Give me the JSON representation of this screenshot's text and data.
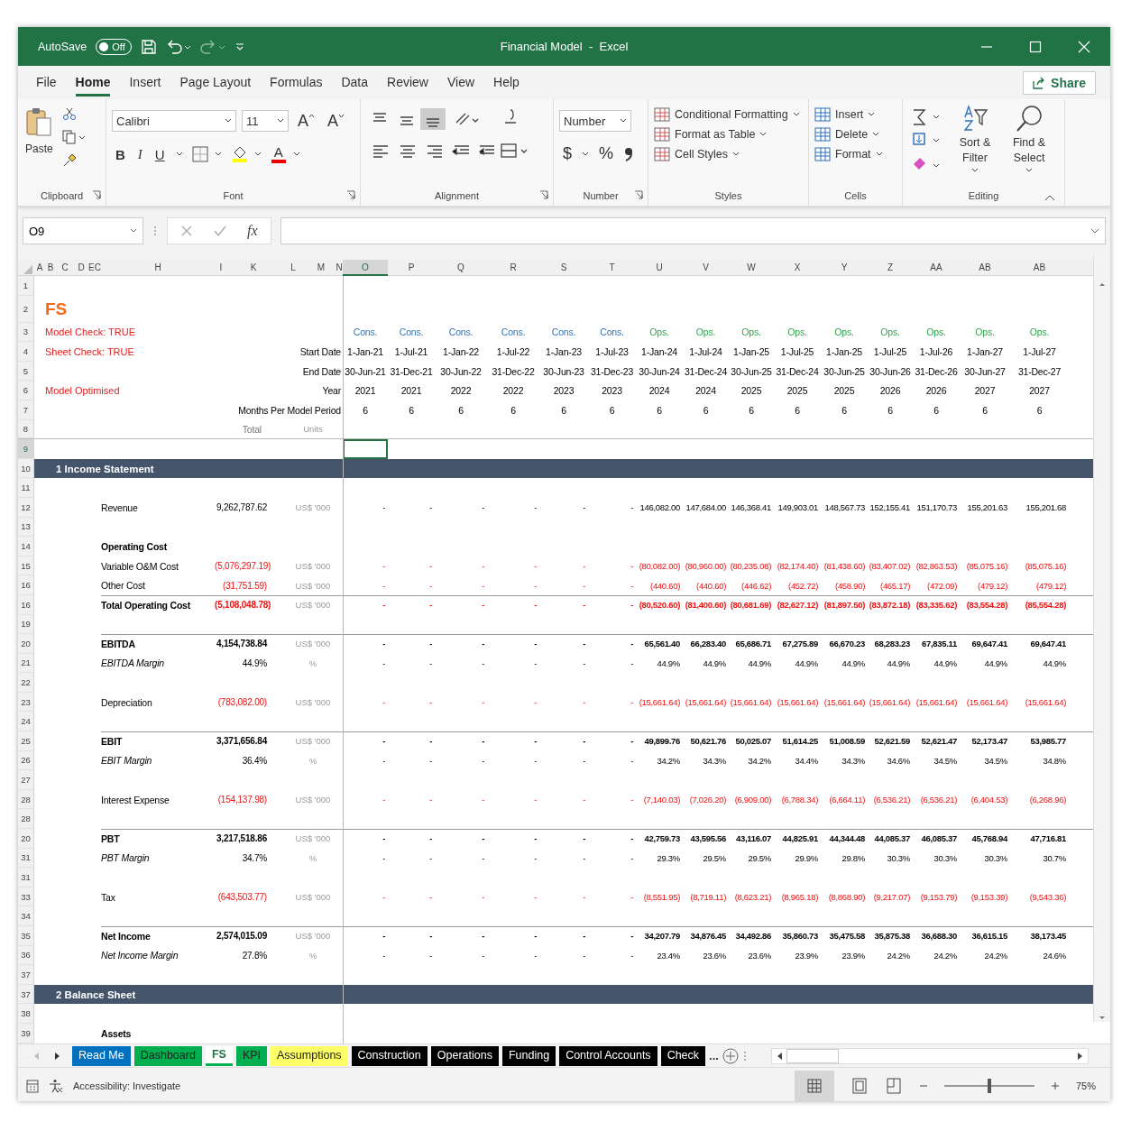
{
  "title_bar": {
    "autosave": "AutoSave",
    "autosave_toggle": {
      "label": "Off",
      "on": false
    },
    "title": "Financial Model  -  Excel"
  },
  "ribbon": {
    "tabs": [
      {
        "label": "File",
        "selected": false
      },
      {
        "label": "Home",
        "selected": true
      },
      {
        "label": "Insert",
        "selected": false
      },
      {
        "label": "Page Layout",
        "selected": false
      },
      {
        "label": "Formulas",
        "selected": false
      },
      {
        "label": "Data",
        "selected": false
      },
      {
        "label": "Review",
        "selected": false
      },
      {
        "label": "View",
        "selected": false
      },
      {
        "label": "Help",
        "selected": false
      }
    ],
    "share": "Share",
    "clipboard": {
      "paste": "Paste",
      "group": "Clipboard"
    },
    "font": {
      "name": "Calibri",
      "size": "11",
      "grow": "A",
      "shrink": "A",
      "styles": [
        "B",
        "I",
        "U"
      ],
      "color_letter": "A",
      "group": "Font"
    },
    "alignment": {
      "group": "Alignment"
    },
    "number": {
      "format": "Number",
      "currency": "$",
      "percent": "%",
      "group": "Number"
    },
    "styles": {
      "items": [
        "Conditional Formatting",
        "Format as Table",
        "Cell Styles"
      ],
      "group": "Styles"
    },
    "cells": {
      "items": [
        "Insert",
        "Delete",
        "Format"
      ],
      "group": "Cells"
    },
    "editing": {
      "sort": "Sort & Filter",
      "find": "Find & Select",
      "group": "Editing"
    }
  },
  "formula_bar": {
    "name_box": "O9",
    "fx": "fx"
  },
  "sheet": {
    "columns": [
      {
        "label": "A",
        "selected": false
      },
      {
        "label": "B",
        "selected": false
      },
      {
        "label": "C",
        "selected": false
      },
      {
        "label": "D",
        "selected": false
      },
      {
        "label": "EC",
        "selected": false
      },
      {
        "label": "H",
        "selected": false
      },
      {
        "label": "I",
        "selected": false
      },
      {
        "label": "K",
        "selected": false
      },
      {
        "label": "L",
        "selected": false
      },
      {
        "label": "M",
        "selected": false
      },
      {
        "label": "N",
        "selected": false
      },
      {
        "label": "O",
        "selected": true
      },
      {
        "label": "P",
        "selected": false
      },
      {
        "label": "Q",
        "selected": false
      },
      {
        "label": "R",
        "selected": false
      },
      {
        "label": "S",
        "selected": false
      },
      {
        "label": "T",
        "selected": false
      },
      {
        "label": "U",
        "selected": false
      },
      {
        "label": "V",
        "selected": false
      },
      {
        "label": "W",
        "selected": false
      },
      {
        "label": "X",
        "selected": false
      },
      {
        "label": "Y",
        "selected": false
      },
      {
        "label": "Z",
        "selected": false
      },
      {
        "label": "AA",
        "selected": false
      },
      {
        "label": "AB",
        "selected": false
      },
      {
        "label": "AB",
        "selected": false
      }
    ],
    "periods": [
      {
        "phase": "Cons.",
        "kind": "construction",
        "start": "1-Jan-21",
        "end": "30-Jun-21",
        "year": "2021",
        "months": "6"
      },
      {
        "phase": "Cons.",
        "kind": "construction",
        "start": "1-Jul-21",
        "end": "31-Dec-21",
        "year": "2021",
        "months": "6"
      },
      {
        "phase": "Cons.",
        "kind": "construction",
        "start": "1-Jan-22",
        "end": "30-Jun-22",
        "year": "2022",
        "months": "6"
      },
      {
        "phase": "Cons.",
        "kind": "construction",
        "start": "1-Jul-22",
        "end": "31-Dec-22",
        "year": "2022",
        "months": "6"
      },
      {
        "phase": "Cons.",
        "kind": "construction",
        "start": "1-Jan-23",
        "end": "30-Jun-23",
        "year": "2023",
        "months": "6"
      },
      {
        "phase": "Cons.",
        "kind": "construction",
        "start": "1-Jul-23",
        "end": "31-Dec-23",
        "year": "2023",
        "months": "6"
      },
      {
        "phase": "Ops.",
        "kind": "operations",
        "start": "1-Jan-24",
        "end": "30-Jun-24",
        "year": "2024",
        "months": "6"
      },
      {
        "phase": "Ops.",
        "kind": "operations",
        "start": "1-Jul-24",
        "end": "31-Dec-24",
        "year": "2024",
        "months": "6"
      },
      {
        "phase": "Ops.",
        "kind": "operations",
        "start": "1-Jan-25",
        "end": "30-Jun-25",
        "year": "2025",
        "months": "6"
      },
      {
        "phase": "Ops.",
        "kind": "operations",
        "start": "1-Jul-25",
        "end": "31-Dec-24",
        "year": "2025",
        "months": "6"
      },
      {
        "phase": "Ops.",
        "kind": "operations",
        "start": "1-Jan-25",
        "end": "30-Jun-25",
        "year": "2025",
        "months": "6"
      },
      {
        "phase": "Ops.",
        "kind": "operations",
        "start": "1-Jul-25",
        "end": "30-Jun-26",
        "year": "2026",
        "months": "6"
      },
      {
        "phase": "Ops.",
        "kind": "operations",
        "start": "1-Jul-26",
        "end": "31-Dec-26",
        "year": "2026",
        "months": "6"
      },
      {
        "phase": "Ops.",
        "kind": "operations",
        "start": "1-Jan-27",
        "end": "30-Jun-27",
        "year": "2027",
        "months": "6"
      },
      {
        "phase": "Ops.",
        "kind": "operations",
        "start": "1-Jul-27",
        "end": "31-Dec-27",
        "year": "2027",
        "months": "6"
      }
    ],
    "rows": [
      {
        "num": "1",
        "kind": "blank",
        "selected": false
      },
      {
        "num": "2",
        "kind": "sheet-title",
        "text": "FS",
        "selected": false
      },
      {
        "num": "3",
        "kind": "phase",
        "note": "Model Check: TRUE",
        "selected": false
      },
      {
        "num": "4",
        "kind": "start",
        "note": "Sheet Check: TRUE",
        "label": "Start Date",
        "selected": false
      },
      {
        "num": "5",
        "kind": "end",
        "label": "End Date",
        "selected": false
      },
      {
        "num": "6",
        "kind": "year",
        "note": "Model Optimised",
        "label": "Year",
        "selected": false
      },
      {
        "num": "7",
        "kind": "months",
        "label": "Months Per Model Period",
        "selected": false
      },
      {
        "num": "8",
        "kind": "column-labels",
        "total": "Total",
        "units": "Units",
        "selected": false
      },
      {
        "num": "9",
        "kind": "blank",
        "selected": true
      },
      {
        "num": "10",
        "kind": "section",
        "text": "1  Income Statement",
        "selected": false
      },
      {
        "num": "11",
        "kind": "blank",
        "selected": false
      },
      {
        "num": "12",
        "kind": "line",
        "label": "Revenue",
        "total": "9,262,787.62",
        "units": "US$ '000",
        "values": [
          "-",
          "-",
          "-",
          "-",
          "-",
          "-",
          "146,082.00",
          "147,684.00",
          "146,368.41",
          "149,903.01",
          "148,567.73",
          "152,155.41",
          "151,170.73",
          "155,201.63",
          "155,201.68"
        ],
        "selected": false
      },
      {
        "num": "13",
        "kind": "blank",
        "selected": false
      },
      {
        "num": "14",
        "kind": "subheading",
        "label": "Operating Cost",
        "selected": false
      },
      {
        "num": "15",
        "kind": "cost",
        "label": "Variable O&M Cost",
        "total": "(5,076,297.19)",
        "units": "US$ '000",
        "values": [
          "-",
          "-",
          "-",
          "-",
          "-",
          "-",
          "(80,082.00)",
          "(80,960.00)",
          "(80,235.08)",
          "(82,174.40)",
          "(81,438.60)",
          "(83,407.02)",
          "(82,863.53)",
          "(85,075.16)",
          "(85,075.16)"
        ],
        "selected": false
      },
      {
        "num": "16",
        "kind": "cost",
        "label": "Other Cost",
        "total": "(31,751.59)",
        "units": "US$ '000",
        "values": [
          "-",
          "-",
          "-",
          "-",
          "-",
          "-",
          "(440.60)",
          "(440.60)",
          "(446.62)",
          "(452.72)",
          "(458.90)",
          "(465.17)",
          "(472.09)",
          "(479.12)",
          "(479.12)"
        ],
        "selected": false
      },
      {
        "num": "16",
        "kind": "total-cost",
        "label": "Total Operating Cost",
        "total": "(5,108,048.78)",
        "units": "US$ '000",
        "values": [
          "-",
          "-",
          "-",
          "-",
          "-",
          "-",
          "(80,520.60)",
          "(81,400.60)",
          "(80,681.69)",
          "(82,627.12)",
          "(81,897.50)",
          "(83,872.18)",
          "(83,335.62)",
          "(83,554.28)",
          "(85,554.28)"
        ],
        "selected": false
      },
      {
        "num": "19",
        "kind": "blank",
        "selected": false
      },
      {
        "num": "20",
        "kind": "total",
        "label": "EBITDA",
        "total": "4,154,738.84",
        "units": "US$ '000",
        "values": [
          "-",
          "-",
          "-",
          "-",
          "-",
          "-",
          "65,561.40",
          "66,283.40",
          "65,686.71",
          "67,275.89",
          "66,670.23",
          "68,283.23",
          "67,835.11",
          "69,647.41",
          "69,647.41"
        ],
        "selected": false
      },
      {
        "num": "21",
        "kind": "margin",
        "label": "EBITDA Margin",
        "total": "44.9%",
        "units": "%",
        "values": [
          "-",
          "-",
          "-",
          "-",
          "-",
          "-",
          "44.9%",
          "44.9%",
          "44.9%",
          "44.9%",
          "44.9%",
          "44.9%",
          "44.9%",
          "44.9%",
          "44.9%"
        ],
        "selected": false
      },
      {
        "num": "22",
        "kind": "blank",
        "selected": false
      },
      {
        "num": "23",
        "kind": "cost",
        "label": "Depreciation",
        "total": "(783,082.00)",
        "units": "US$ '000",
        "values": [
          "-",
          "-",
          "-",
          "-",
          "-",
          "-",
          "(15,661.64)",
          "(15,661.64)",
          "(15,661.64)",
          "(15,661.64)",
          "(15,661.64)",
          "(15,661.64)",
          "(15,661.64)",
          "(15,661.64)",
          "(15,661.64)"
        ],
        "selected": false
      },
      {
        "num": "24",
        "kind": "blank",
        "selected": false
      },
      {
        "num": "25",
        "kind": "total",
        "label": "EBIT",
        "total": "3,371,656.84",
        "units": "US$ '000",
        "values": [
          "-",
          "-",
          "-",
          "-",
          "-",
          "-",
          "49,899.76",
          "50,621.76",
          "50,025.07",
          "51,614.25",
          "51,008.59",
          "52,621.59",
          "52,621.47",
          "52,173.47",
          "53,985.77"
        ],
        "selected": false
      },
      {
        "num": "26",
        "kind": "margin",
        "label": "EBIT Margin",
        "total": "36.4%",
        "units": "%",
        "values": [
          "-",
          "-",
          "-",
          "-",
          "-",
          "-",
          "34.2%",
          "34.3%",
          "34.2%",
          "34.4%",
          "34.3%",
          "34.6%",
          "34.5%",
          "34.5%",
          "34.8%"
        ],
        "selected": false
      },
      {
        "num": "27",
        "kind": "blank",
        "selected": false
      },
      {
        "num": "28",
        "kind": "cost",
        "label": "Interest Expense",
        "total": "(154,137.98)",
        "units": "US$ '000",
        "values": [
          "-",
          "-",
          "-",
          "-",
          "-",
          "-",
          "(7,140.03)",
          "(7,026.20)",
          "(6,909.00)",
          "(6,788.34)",
          "(6,664.11)",
          "(6,536.21)",
          "(6,536.21)",
          "(6,404.53)",
          "(6,268.96)"
        ],
        "selected": false
      },
      {
        "num": "28",
        "kind": "blank",
        "selected": false
      },
      {
        "num": "20",
        "kind": "total",
        "label": "PBT",
        "total": "3,217,518.86",
        "units": "US$ '000",
        "values": [
          "-",
          "-",
          "-",
          "-",
          "-",
          "-",
          "42,759.73",
          "43,595.56",
          "43,116.07",
          "44,825.91",
          "44,344.48",
          "44,085.37",
          "46,085.37",
          "45,768.94",
          "47,716.81"
        ],
        "selected": false
      },
      {
        "num": "31",
        "kind": "margin",
        "label": "PBT Margin",
        "total": "34.7%",
        "units": "%",
        "values": [
          "-",
          "-",
          "-",
          "-",
          "-",
          "-",
          "29.3%",
          "29.5%",
          "29.5%",
          "29.9%",
          "29.8%",
          "30.3%",
          "30.3%",
          "30.3%",
          "30.7%"
        ],
        "selected": false
      },
      {
        "num": "31",
        "kind": "blank",
        "selected": false
      },
      {
        "num": "33",
        "kind": "cost",
        "label": "Tax",
        "total": "(643,503.77)",
        "units": "US$ '000",
        "values": [
          "-",
          "-",
          "-",
          "-",
          "-",
          "-",
          "(8,551.95)",
          "(8,719.11)",
          "(8,623.21)",
          "(8,965.18)",
          "(8,868.90)",
          "(9,217.07)",
          "(9,153.79)",
          "(9,153.39)",
          "(9,543.36)"
        ],
        "selected": false
      },
      {
        "num": "34",
        "kind": "blank",
        "selected": false
      },
      {
        "num": "35",
        "kind": "total",
        "label": "Net Income",
        "total": "2,574,015.09",
        "units": "US$ '000",
        "values": [
          "-",
          "-",
          "-",
          "-",
          "-",
          "-",
          "34,207.79",
          "34,876.45",
          "34,492.86",
          "35,860.73",
          "35,475.58",
          "35,875.38",
          "36,688.30",
          "36,615.15",
          "38,173.45"
        ],
        "selected": false
      },
      {
        "num": "36",
        "kind": "margin",
        "label": "Net Income Margin",
        "total": "27.8%",
        "units": "%",
        "values": [
          "-",
          "-",
          "-",
          "-",
          "-",
          "-",
          "23.4%",
          "23.6%",
          "23.6%",
          "23.9%",
          "23.9%",
          "24.2%",
          "24.2%",
          "24.2%",
          "24.6%"
        ],
        "selected": false
      },
      {
        "num": "37",
        "kind": "blank",
        "selected": false
      },
      {
        "num": "37",
        "kind": "section",
        "text": "2  Balance Sheet",
        "selected": false
      },
      {
        "num": "38",
        "kind": "blank",
        "selected": false
      },
      {
        "num": "39",
        "kind": "subheading",
        "label": "Assets",
        "selected": false
      }
    ]
  },
  "sheet_tabs": {
    "tabs": [
      {
        "label": "Read Me",
        "color": "#0070c0",
        "selected": false
      },
      {
        "label": "Dashboard",
        "color": "#00b050",
        "selected": false
      },
      {
        "label": "FS",
        "color": "#00b050",
        "selected": true
      },
      {
        "label": "KPI",
        "color": "#00b050",
        "selected": false
      },
      {
        "label": "Assumptions",
        "color": "#ffff66",
        "selected": false
      },
      {
        "label": "Construction",
        "color": "#000000",
        "selected": false
      },
      {
        "label": "Operations",
        "color": "#000000",
        "selected": false
      },
      {
        "label": "Funding",
        "color": "#000000",
        "selected": false
      },
      {
        "label": "Control Accounts",
        "color": "#000000",
        "selected": false
      },
      {
        "label": "Check",
        "color": "#000000",
        "selected": false
      }
    ],
    "more": "..."
  },
  "status_bar": {
    "accessibility": "Accessibility: Investigate",
    "zoom_level": {
      "level": 0.5
    },
    "zoom": "75%"
  }
}
